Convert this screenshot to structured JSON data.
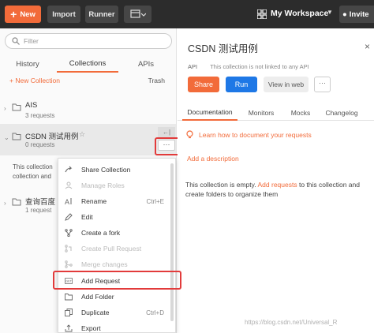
{
  "topbar": {
    "new_label": "New",
    "import_label": "Import",
    "runner_label": "Runner",
    "workspace_label": "My Workspace",
    "invite_label": "Invite"
  },
  "sidebar": {
    "filter_placeholder": "Filter",
    "tabs": [
      "History",
      "Collections",
      "APIs"
    ],
    "active_tab": "Collections",
    "new_collection_label": "+ New Collection",
    "trash_label": "Trash",
    "collections": [
      {
        "name": "AIS",
        "requests": "3 requests"
      },
      {
        "name": "CSDN 测试用例",
        "requests": "0 requests"
      },
      {
        "name": "查询百度",
        "requests": "1 request"
      }
    ],
    "empty_note_line1": "This collection",
    "empty_note_line2": "collection and"
  },
  "context_menu": {
    "items": [
      {
        "label": "Share Collection",
        "shortcut": "",
        "disabled": false
      },
      {
        "label": "Manage Roles",
        "shortcut": "",
        "disabled": true
      },
      {
        "label": "Rename",
        "shortcut": "Ctrl+E",
        "disabled": false
      },
      {
        "label": "Edit",
        "shortcut": "",
        "disabled": false
      },
      {
        "label": "Create a fork",
        "shortcut": "",
        "disabled": false
      },
      {
        "label": "Create Pull Request",
        "shortcut": "",
        "disabled": true
      },
      {
        "label": "Merge changes",
        "shortcut": "",
        "disabled": true
      },
      {
        "label": "Add Request",
        "shortcut": "",
        "disabled": false
      },
      {
        "label": "Add Folder",
        "shortcut": "",
        "disabled": false
      },
      {
        "label": "Duplicate",
        "shortcut": "Ctrl+D",
        "disabled": false
      },
      {
        "label": "Export",
        "shortcut": "",
        "disabled": false
      }
    ]
  },
  "main": {
    "title": "CSDN 测试用例",
    "api_label": "API",
    "api_status": "This collection is not linked to any API",
    "share_label": "Share",
    "run_label": "Run",
    "view_web_label": "View in web",
    "tabs": [
      "Documentation",
      "Monitors",
      "Mocks",
      "Changelog"
    ],
    "active_tab": "Documentation",
    "learn_link": "Learn how to document your requests",
    "add_description": "Add a description",
    "empty_pre": "This collection is empty. ",
    "empty_link": "Add requests",
    "empty_post": " to this collection and create folders to organize them"
  },
  "watermark": "https://blog.csdn.net/Universal_R",
  "colors": {
    "accent": "#f26b3a",
    "run_blue": "#1e78e6",
    "topbar": "#2c2c2c",
    "highlight_red": "#e23b3b"
  }
}
